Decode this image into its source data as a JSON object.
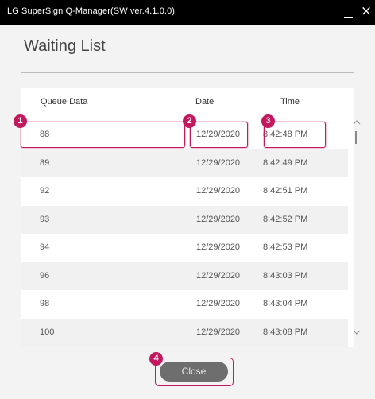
{
  "window": {
    "title": "LG SuperSign Q-Manager(SW ver.4.1.0.0)",
    "close_glyph": "×"
  },
  "page": {
    "heading": "Waiting List"
  },
  "table": {
    "columns": [
      "Queue Data",
      "Date",
      "Time"
    ],
    "rows": [
      {
        "queue": "88",
        "date": "12/29/2020",
        "time": "8:42:48 PM"
      },
      {
        "queue": "89",
        "date": "12/29/2020",
        "time": "8:42:49 PM"
      },
      {
        "queue": "92",
        "date": "12/29/2020",
        "time": "8:42:51 PM"
      },
      {
        "queue": "93",
        "date": "12/29/2020",
        "time": "8:42:52 PM"
      },
      {
        "queue": "94",
        "date": "12/29/2020",
        "time": "8:42:53 PM"
      },
      {
        "queue": "96",
        "date": "12/29/2020",
        "time": "8:43:03 PM"
      },
      {
        "queue": "98",
        "date": "12/29/2020",
        "time": "8:43:04 PM"
      },
      {
        "queue": "100",
        "date": "12/29/2020",
        "time": "8:43:08 PM"
      }
    ]
  },
  "footer": {
    "close_label": "Close"
  },
  "callouts": [
    "1",
    "2",
    "3",
    "4"
  ],
  "colors": {
    "callout": "#c1185e",
    "titlebar": "#000000",
    "close_button": "#6e6e6e"
  }
}
